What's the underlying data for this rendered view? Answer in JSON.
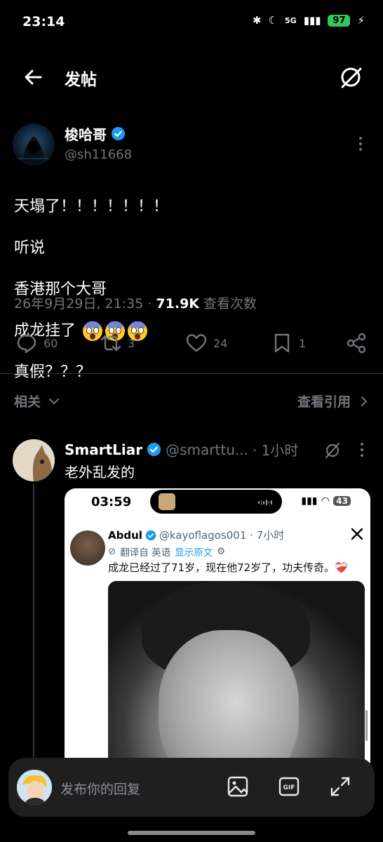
{
  "status_bar": {
    "time": "23:14",
    "network": "5G",
    "battery": "97"
  },
  "header": {
    "title": "发帖"
  },
  "post": {
    "author": "梭哈哥",
    "handle": "@sh11668",
    "lines": [
      "天塌了！！！！！！！",
      "听说",
      "香港那个大哥",
      "成龙挂了",
      "真假？？？"
    ],
    "date_time": "26年9月29日, 21:35 · ",
    "views": "71.9K",
    "views_label": " 查看次数",
    "replies": "60",
    "reposts": "3",
    "likes": "24",
    "bookmarks": "1"
  },
  "related_bar": {
    "related": "相关",
    "view_quotes": "查看引用"
  },
  "reply": {
    "author": "SmartLiar",
    "handle": "@smarttu...",
    "time": "· 1小时",
    "text": "老外乱发的",
    "embed": {
      "time": "03:59",
      "battery": "43",
      "name": "Abdul",
      "handle": "@kayoflagos001 · 7小时",
      "translated_from": "翻译自 英语",
      "show_original": "显示原文",
      "text": "成龙已经过了71岁，现在他72岁了，功夫传奇。❤️‍🩹"
    }
  },
  "composer": {
    "placeholder": "发布你的回复"
  },
  "colors": {
    "accent": "#1d9bf0",
    "background": "#000000",
    "muted": "#71767b"
  }
}
